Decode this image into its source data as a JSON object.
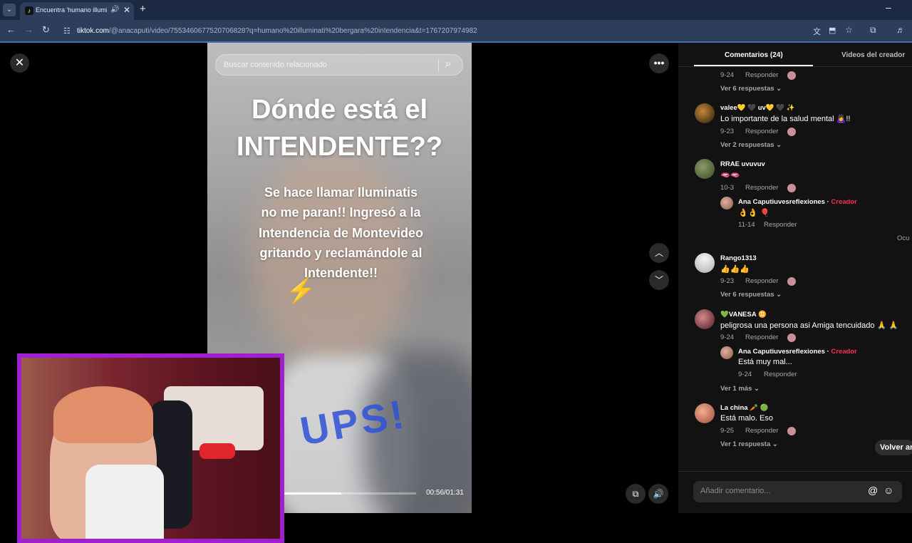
{
  "browser": {
    "tab_title": "Encuentra 'humano illumin",
    "url_host": "tiktok.com",
    "url_path": "/@anacaputi/video/7553460677520706828?q=humano%20illuminati%20bergara%20intendencia&t=1767207974982"
  },
  "search": {
    "placeholder": "Buscar contenido relacionado"
  },
  "video": {
    "headline": "Dónde está el INTENDENTE??",
    "subtext": "Se hace llamar Iluminatis no me paran!! Ingresó a la Intendencia de Montevideo gritando y reclamándole al Intendente!!",
    "overlay_word": "UPS!",
    "time": "00:56/01:31",
    "progress": 0.43
  },
  "panel": {
    "tab_comments": "Comentarios (24)",
    "tab_creator": "Videos del creador",
    "oculto": "Ocu",
    "volver": "Volver arr",
    "input_placeholder": "Añadir comentario...",
    "top": {
      "date": "9-24",
      "reply": "Responder",
      "view": "Ver 6 respuestas ⌄"
    },
    "comments": [
      {
        "user": "valee💛 🖤 uv💛 🖤 ✨",
        "text": "Lo importante de la salud mental 🙇‍♀️!!",
        "date": "9-23",
        "reply": "Responder",
        "view": "Ver 2 respuestas ⌄",
        "avatar": "#6a4a2a"
      },
      {
        "user": "RRAE uvuvuv",
        "text": "🫦🫦",
        "date": "10-3",
        "reply": "Responder",
        "avatar": "#5a6a3a",
        "sub": {
          "user": "Ana Caputiuvesreflexiones",
          "badge": "Creador",
          "text": "👌👌 🎈",
          "date": "11-14",
          "reply": "Responder"
        }
      },
      {
        "user": "Rango1313",
        "text": "👍👍👍",
        "date": "9-23",
        "reply": "Responder",
        "view": "Ver 6 respuestas ⌄",
        "avatar": "#d8d8d8"
      },
      {
        "user": "💚VANESA ♊",
        "text": "peligrosa una persona asi Amiga tencuidado 🙏 🙏",
        "date": "9-24",
        "reply": "Responder",
        "avatar": "#7a2a3a",
        "sub": {
          "user": "Ana Caputiuvesreflexiones",
          "badge": "Creador",
          "text": "Está muy mal...",
          "date": "9-24",
          "reply": "Responder"
        },
        "view": "Ver 1 más ⌄"
      },
      {
        "user": "La china 🥕 🟢",
        "text": "Está malo. Eso",
        "date": "9-25",
        "reply": "Responder",
        "view": "Ver 1 respuesta ⌄",
        "avatar": "#c87a6a"
      }
    ]
  },
  "colors": {
    "accent": "#fe2c55",
    "frame": "#a020d0"
  },
  "icons": [
    "close-icon",
    "search-icon",
    "more-icon",
    "chevron-up-icon",
    "chevron-down-icon",
    "pip-icon",
    "volume-icon",
    "at-icon",
    "emoji-icon"
  ]
}
